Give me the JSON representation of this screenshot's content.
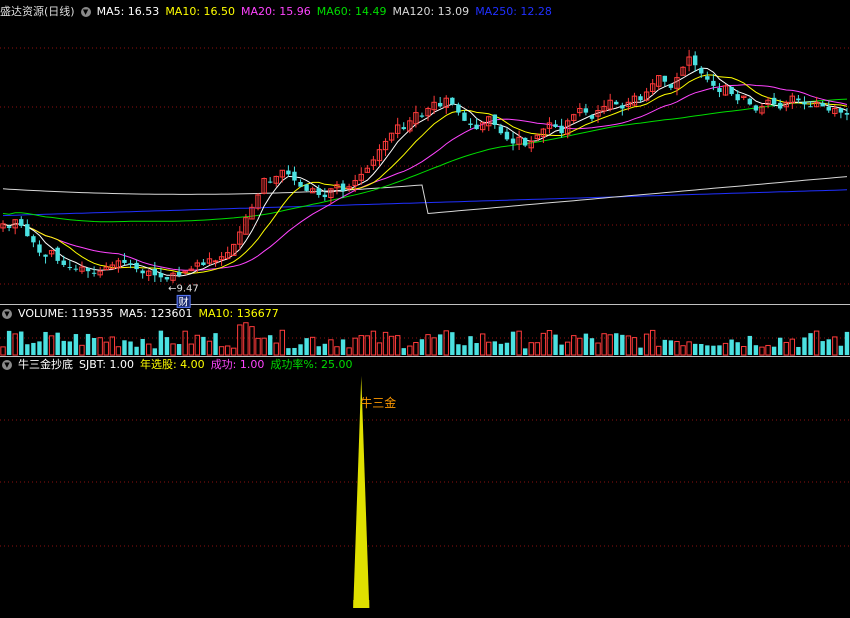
{
  "colors": {
    "up": "#ff3b3b",
    "down": "#4be1e1",
    "ma5": "#ffffff",
    "ma10": "#ffff00",
    "ma20": "#ff44ff",
    "ma60": "#00dd00",
    "ma120": "#d8d8d8",
    "ma250": "#2030ff",
    "grid": "#8b1010",
    "indicator_fill": "#e0e000",
    "signal_text": "#ff9900"
  },
  "price_panel": {
    "title": "盛达资源(日线)",
    "toggle_icon": "chevron-down-icon",
    "ma_labels": [
      {
        "key": "ma5",
        "text": "MA5: 16.53"
      },
      {
        "key": "ma10",
        "text": "MA10: 16.50"
      },
      {
        "key": "ma20",
        "text": "MA20: 15.96"
      },
      {
        "key": "ma60",
        "text": "MA60: 14.49"
      },
      {
        "key": "ma120",
        "text": "MA120: 13.09"
      },
      {
        "key": "ma250",
        "text": "MA250: 12.28"
      }
    ],
    "low_marker": "9.47",
    "event_badge": "财"
  },
  "volume_panel": {
    "toggle_icon": "chevron-down-icon",
    "labels": [
      {
        "key": "ma5",
        "text": "VOLUME: 119535"
      },
      {
        "key": "ma5",
        "text": "MA5: 123601"
      },
      {
        "key": "ma10",
        "text": "MA10: 136677"
      }
    ]
  },
  "indicator_panel": {
    "toggle_icon": "chevron-down-icon",
    "labels": [
      {
        "key": "ma5",
        "text": "牛三金抄底"
      },
      {
        "key": "ma5",
        "text": "SJBT: 1.00"
      },
      {
        "key": "ma10",
        "text": "年选股: 4.00"
      },
      {
        "key": "ma20",
        "text": "成功: 1.00"
      },
      {
        "key": "ma60",
        "text": "成功率%: 25.00"
      }
    ],
    "signal_label": "牛三金"
  },
  "chart_data": {
    "type": "candlestick",
    "series_count": 140,
    "price_range": [
      8.5,
      22.0
    ],
    "close": [
      12.2,
      12.0,
      12.4,
      12.1,
      11.6,
      11.3,
      10.8,
      10.6,
      10.9,
      10.4,
      10.2,
      10.1,
      10.0,
      10.1,
      9.9,
      9.8,
      9.9,
      10.1,
      10.2,
      10.4,
      10.3,
      10.2,
      10.0,
      9.8,
      9.9,
      9.7,
      9.6,
      9.5,
      9.8,
      9.7,
      9.9,
      10.0,
      10.3,
      10.2,
      10.5,
      10.4,
      10.6,
      10.8,
      11.2,
      11.8,
      12.5,
      13.0,
      13.6,
      14.4,
      14.2,
      14.5,
      14.8,
      14.6,
      14.3,
      14.0,
      13.8,
      13.9,
      13.6,
      13.5,
      13.9,
      14.1,
      13.8,
      14.0,
      14.3,
      14.6,
      14.9,
      15.3,
      15.8,
      16.2,
      16.6,
      17.0,
      16.8,
      17.2,
      17.6,
      17.4,
      17.8,
      18.1,
      17.9,
      18.3,
      18.0,
      17.6,
      17.2,
      17.0,
      16.8,
      17.1,
      17.4,
      17.0,
      16.6,
      16.3,
      16.1,
      16.4,
      16.0,
      16.2,
      16.5,
      16.8,
      17.1,
      16.9,
      16.6,
      17.2,
      17.5,
      17.8,
      17.6,
      17.3,
      17.7,
      17.9,
      18.2,
      18.0,
      17.8,
      18.1,
      18.4,
      18.2,
      18.6,
      19.0,
      19.4,
      19.1,
      18.8,
      19.3,
      19.8,
      20.3,
      19.9,
      19.5,
      19.2,
      18.9,
      18.6,
      18.9,
      18.5,
      18.2,
      18.4,
      18.0,
      17.7,
      17.9,
      18.2,
      18.0,
      17.8,
      18.1,
      18.4,
      18.2,
      18.0,
      17.9,
      18.1,
      17.9,
      17.7,
      17.8,
      17.6,
      17.5
    ],
    "volume_scale": [
      0,
      400000
    ],
    "indicator": {
      "name": "SJBT",
      "peak_index": 59,
      "value": 1.0
    }
  }
}
